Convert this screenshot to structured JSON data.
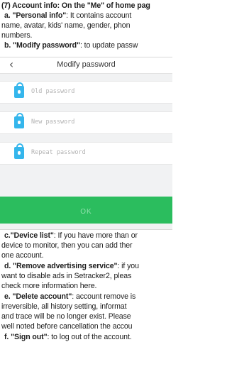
{
  "heading": {
    "number": "(7)",
    "text": "Account info: On the \"Me\" of home pag"
  },
  "item_a": {
    "label": "a. \"Personal info\"",
    "text1": ": It contains account",
    "line2": "name, avatar, kids' name, gender, phon",
    "line3": "numbers."
  },
  "item_b": {
    "label": "b. \"Modify password\"",
    "text1": ": to update passw"
  },
  "screen": {
    "title": "Modify password",
    "fields": [
      {
        "placeholder": "Old password"
      },
      {
        "placeholder": "New password"
      },
      {
        "placeholder": "Repeat password"
      }
    ],
    "ok_label": "OK"
  },
  "item_c": {
    "label": "c.\"Device list\"",
    "text1": ": If you have more than or",
    "line2": "device to monitor, then you can add ther",
    "line3": "one account."
  },
  "item_d": {
    "label": "d. \"Remove advertising service\"",
    "text1": ": if you",
    "line2": "want to disable ads in Setracker2, pleas",
    "line3": "check more information here."
  },
  "item_e": {
    "label": "e. \"Delete account\"",
    "text1": ": account remove is",
    "line2": "irreversible, all history setting, informat",
    "line3": "and trace will be no longer exist. Please",
    "line4": "well noted before cancellation the accou"
  },
  "item_f": {
    "label": "f. \"Sign out\"",
    "text1": ": to log out of the account."
  }
}
